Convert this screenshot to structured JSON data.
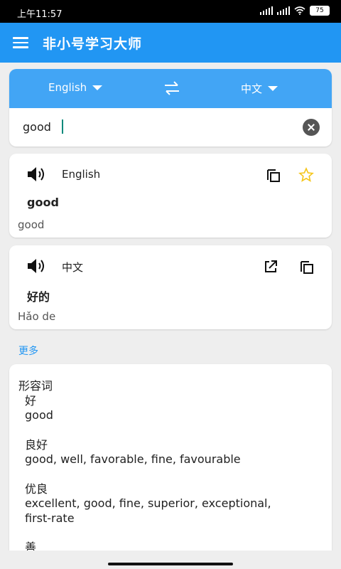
{
  "status_bar": {
    "time": "上午11:57",
    "battery": "75"
  },
  "app": {
    "title": "非小号学习大师"
  },
  "translator": {
    "source_lang": "English",
    "target_lang": "中文",
    "input_value": "good"
  },
  "result_source": {
    "lang": "English",
    "word": "good",
    "phonetic": "good"
  },
  "result_target": {
    "lang": "中文",
    "word": "好的",
    "phonetic": "Hǎo de"
  },
  "more_label": "更多",
  "definitions": {
    "pos": "形容词",
    "entries": [
      {
        "word": "好",
        "translations": "good"
      },
      {
        "word": "良好",
        "translations": "good, well, favorable, fine, favourable"
      },
      {
        "word": "优良",
        "translations": "excellent, good, fine, superior, exceptional,",
        "translations_cont": "first-rate"
      },
      {
        "word": "善",
        "translations": ""
      }
    ]
  },
  "colors": {
    "primary": "#2196f3",
    "lang_bar": "#42a5f5",
    "star": "#f5c518"
  },
  "icons": [
    "menu-icon",
    "swap-icon",
    "clear-icon",
    "speaker-icon",
    "copy-icon",
    "star-icon",
    "open-external-icon"
  ]
}
